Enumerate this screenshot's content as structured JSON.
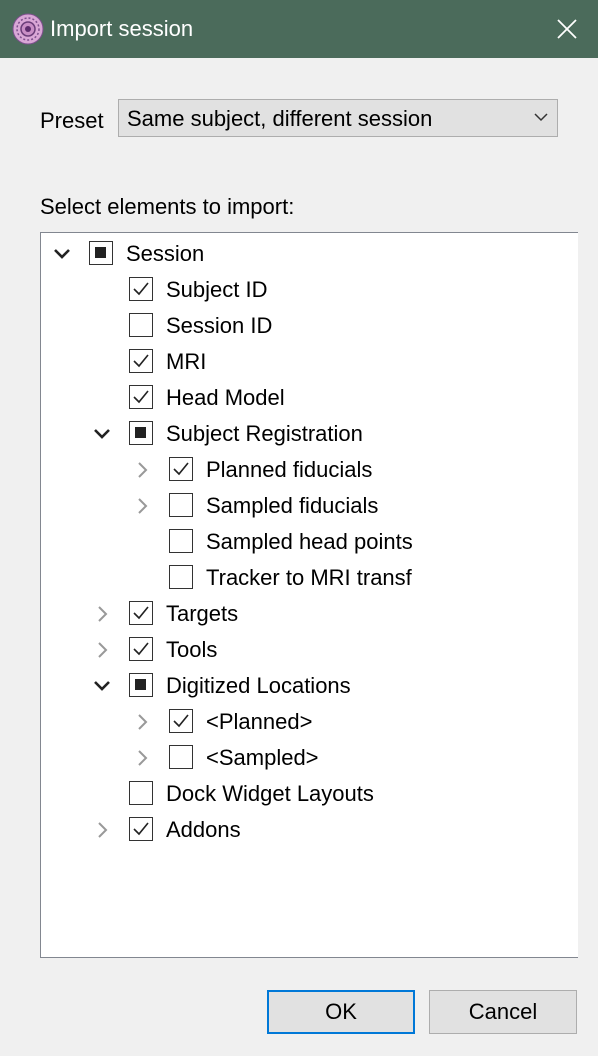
{
  "window": {
    "title": "Import session",
    "close_icon": "close-icon",
    "app_icon": "app-logo-icon"
  },
  "preset": {
    "label": "Preset",
    "value": "Same subject, different session"
  },
  "tree_label": "Select elements to import:",
  "tree_items": [
    {
      "label": "Session",
      "depth": 0,
      "expander": "expanded",
      "state": "partial"
    },
    {
      "label": "Subject ID",
      "depth": 1,
      "expander": "none",
      "state": "checked"
    },
    {
      "label": "Session ID",
      "depth": 1,
      "expander": "none",
      "state": "unchecked"
    },
    {
      "label": "MRI",
      "depth": 1,
      "expander": "none",
      "state": "checked"
    },
    {
      "label": "Head Model",
      "depth": 1,
      "expander": "none",
      "state": "checked"
    },
    {
      "label": "Subject Registration",
      "depth": 1,
      "expander": "expanded",
      "state": "partial"
    },
    {
      "label": "Planned fiducials",
      "depth": 2,
      "expander": "collapsed",
      "state": "checked"
    },
    {
      "label": "Sampled fiducials",
      "depth": 2,
      "expander": "collapsed",
      "state": "unchecked"
    },
    {
      "label": "Sampled head points",
      "depth": 2,
      "expander": "none",
      "state": "unchecked"
    },
    {
      "label": "Tracker to MRI transf",
      "depth": 2,
      "expander": "none",
      "state": "unchecked"
    },
    {
      "label": "Targets",
      "depth": 1,
      "expander": "collapsed",
      "state": "checked"
    },
    {
      "label": "Tools",
      "depth": 1,
      "expander": "collapsed",
      "state": "checked"
    },
    {
      "label": "Digitized Locations",
      "depth": 1,
      "expander": "expanded",
      "state": "partial"
    },
    {
      "label": "<Planned>",
      "depth": 2,
      "expander": "collapsed",
      "state": "checked"
    },
    {
      "label": "<Sampled>",
      "depth": 2,
      "expander": "collapsed",
      "state": "unchecked"
    },
    {
      "label": "Dock Widget Layouts",
      "depth": 1,
      "expander": "none",
      "state": "unchecked"
    },
    {
      "label": "Addons",
      "depth": 1,
      "expander": "collapsed",
      "state": "checked"
    }
  ],
  "buttons": {
    "ok": "OK",
    "cancel": "Cancel"
  },
  "colors": {
    "titlebar": "#4b6b5b",
    "accent": "#0078d7",
    "dialog_bg": "#f0f0f0"
  }
}
